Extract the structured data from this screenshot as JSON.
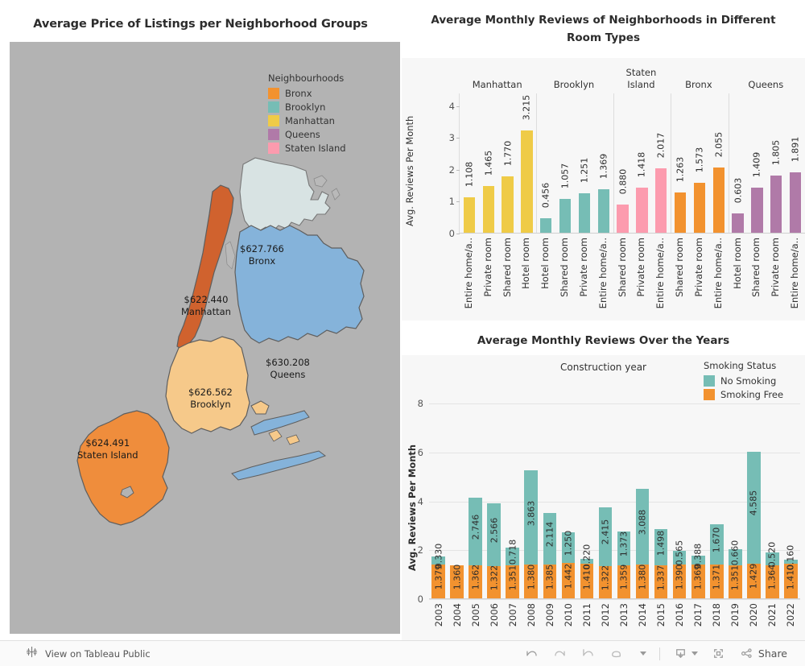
{
  "map_panel": {
    "title": "Average Price of Listings per Neighborhood Groups",
    "legend_title": "Neighbourhoods",
    "legend": [
      {
        "label": "Bronx",
        "color": "#F2922F"
      },
      {
        "label": "Brooklyn",
        "color": "#76BDB5"
      },
      {
        "label": "Manhattan",
        "color": "#EFCB47"
      },
      {
        "label": "Queens",
        "color": "#B07AA8"
      },
      {
        "label": "Staten Island",
        "color": "#FC9BAE"
      }
    ],
    "regions": [
      {
        "name": "Bronx",
        "value": "$627.766",
        "fill": "#d8e3e3"
      },
      {
        "name": "Manhattan",
        "value": "$622.440",
        "fill": "#d0622e"
      },
      {
        "name": "Queens",
        "value": "$630.208",
        "fill": "#85b3da"
      },
      {
        "name": "Brooklyn",
        "value": "$626.562",
        "fill": "#f6c98a"
      },
      {
        "name": "Staten Island",
        "value": "$624.491",
        "fill": "#ef8d3c"
      }
    ],
    "background": "#b3b3b3"
  },
  "room_panel": {
    "title": "Average Monthly Reviews of Neighborhoods in Different Room Types",
    "ylabel": "Avg. Reviews Per Month"
  },
  "years_panel": {
    "title": "Average Monthly Reviews Over the Years",
    "caption": "Construction year",
    "ylabel": "Avg. Reviews Per Month",
    "legend_title": "Smoking Status",
    "legend": [
      {
        "label": "No Smoking",
        "color": "#76BDB5"
      },
      {
        "label": "Smoking Free",
        "color": "#F2922F"
      }
    ]
  },
  "toolbar": {
    "view_label": "View on Tableau Public",
    "share_label": "Share",
    "icons": {
      "tableau": "tableau-icon",
      "undo": "undo-icon",
      "redo": "redo-icon",
      "revert": "revert-icon",
      "refresh": "refresh-icon",
      "pause": "pause-dropdown-icon",
      "download": "download-icon",
      "fullscreen": "fullscreen-icon",
      "share": "share-icon"
    }
  },
  "chart_data": [
    {
      "type": "bar",
      "title": "Average Monthly Reviews of Neighborhoods in Different Room Types",
      "xlabel": "",
      "ylabel": "Avg. Reviews Per Month",
      "ylim": [
        0,
        4.4
      ],
      "yticks": [
        0,
        1,
        2,
        3,
        4
      ],
      "grid": false,
      "legend": "none",
      "groups": [
        {
          "name": "Manhattan",
          "color": "#EFCB47",
          "categories": [
            "Entire home/a..",
            "Private room",
            "Shared room",
            "Hotel room"
          ],
          "values": [
            1.108,
            1.465,
            1.77,
            3.215
          ]
        },
        {
          "name": "Brooklyn",
          "color": "#76BDB5",
          "categories": [
            "Hotel room",
            "Shared room",
            "Private room",
            "Entire home/a.."
          ],
          "values": [
            0.456,
            1.057,
            1.251,
            1.369
          ]
        },
        {
          "name": "Staten Island",
          "color": "#FC9BAE",
          "categories": [
            "Shared room",
            "Private room",
            "Entire home/a.."
          ],
          "values": [
            0.88,
            1.418,
            2.017
          ]
        },
        {
          "name": "Bronx",
          "color": "#F2922F",
          "categories": [
            "Shared room",
            "Private room",
            "Entire home/a.."
          ],
          "values": [
            1.263,
            1.573,
            2.055
          ]
        },
        {
          "name": "Queens",
          "color": "#B07AA8",
          "categories": [
            "Hotel room",
            "Shared room",
            "Private room",
            "Entire home/a.."
          ],
          "values": [
            0.603,
            1.409,
            1.805,
            1.891
          ]
        }
      ]
    },
    {
      "type": "bar",
      "stacked": true,
      "title": "Average Monthly Reviews Over the Years",
      "xlabel": "Construction year",
      "ylabel": "Avg. Reviews Per Month",
      "ylim": [
        0,
        8.8
      ],
      "yticks": [
        0,
        2,
        4,
        6,
        8
      ],
      "grid": true,
      "legend": "right",
      "categories": [
        "2003",
        "2004",
        "2005",
        "2006",
        "2007",
        "2008",
        "2009",
        "2010",
        "2011",
        "2012",
        "2013",
        "2014",
        "2015",
        "2016",
        "2017",
        "2018",
        "2019",
        "2020",
        "2021",
        "2022"
      ],
      "series": [
        {
          "name": "Smoking Free",
          "color": "#F2922F",
          "values": [
            1.379,
            1.36,
            1.362,
            1.322,
            1.351,
            1.38,
            1.385,
            1.442,
            1.41,
            1.322,
            1.359,
            1.38,
            1.337,
            1.39,
            1.369,
            1.371,
            1.351,
            1.429,
            1.364,
            1.41
          ]
        },
        {
          "name": "No Smoking",
          "color": "#76BDB5",
          "values": [
            0.33,
            0.0,
            2.746,
            2.566,
            0.718,
            3.863,
            2.114,
            1.25,
            0.22,
            2.415,
            1.373,
            3.088,
            1.498,
            0.565,
            0.388,
            1.67,
            0.66,
            4.585,
            0.52,
            0.16
          ]
        }
      ]
    }
  ]
}
